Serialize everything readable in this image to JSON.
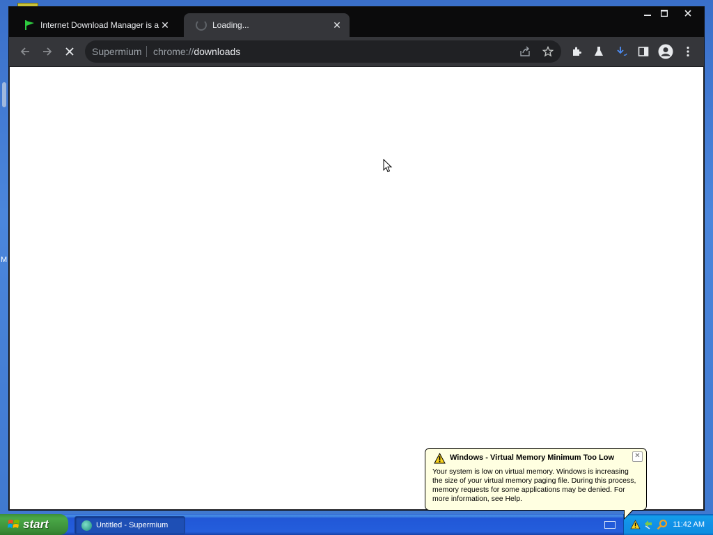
{
  "browser": {
    "tabs": [
      {
        "title": "Internet Download Manager is a po",
        "state": "inactive",
        "favicon": "green-flag-icon"
      },
      {
        "title": "Loading...",
        "state": "active",
        "favicon": "loading-spinner-icon"
      }
    ],
    "omnibox": {
      "site_name": "Supermium",
      "url_scheme": "chrome://",
      "url_host": "downloads"
    }
  },
  "balloon": {
    "title": "Windows - Virtual Memory Minimum Too Low",
    "body": "Your system is low on virtual memory. Windows is increasing the size of your virtual memory paging file. During this process, memory requests for some applications may be denied. For more information, see Help."
  },
  "taskbar": {
    "start_label": "start",
    "window_button": "Untitled - Supermium",
    "clock": "11:42 AM"
  },
  "desktop": {
    "edge_letter": "M"
  }
}
